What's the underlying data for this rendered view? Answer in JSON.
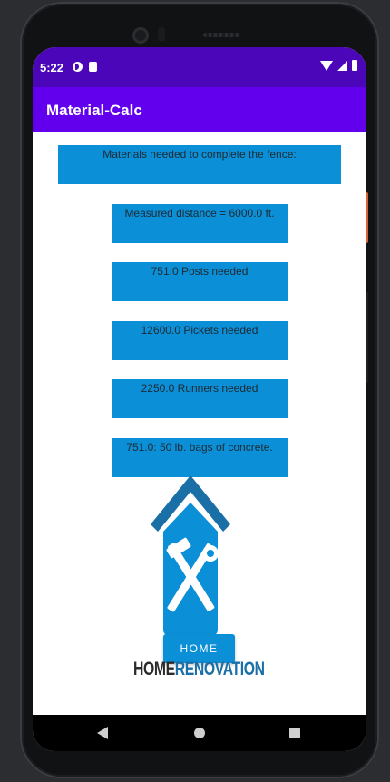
{
  "status_bar": {
    "time": "5:22"
  },
  "app_bar": {
    "title": "Material-Calc"
  },
  "results": {
    "header": "Materials needed to complete the fence:",
    "distance": "Measured distance = 6000.0 ft.",
    "posts": "751.0 Posts needed",
    "pickets": "12600.0 Pickets needed",
    "runners": "2250.0 Runners needed",
    "concrete": "751.0: 50 lb. bags of concrete."
  },
  "home_button": {
    "label": "HOME"
  },
  "logo": {
    "text_home": "HOME",
    "text_renovation": "RENOVATION",
    "icon": "house-hammer-wrench-logo"
  },
  "colors": {
    "status_bar": "#4a06b8",
    "app_bar": "#6200ee",
    "result_box": "#0b8fd6",
    "logo_blue": "#1a6fa7"
  },
  "nav_bar": {
    "back_icon": "back-triangle-icon",
    "home_icon": "home-circle-icon",
    "recents_icon": "recents-square-icon"
  }
}
